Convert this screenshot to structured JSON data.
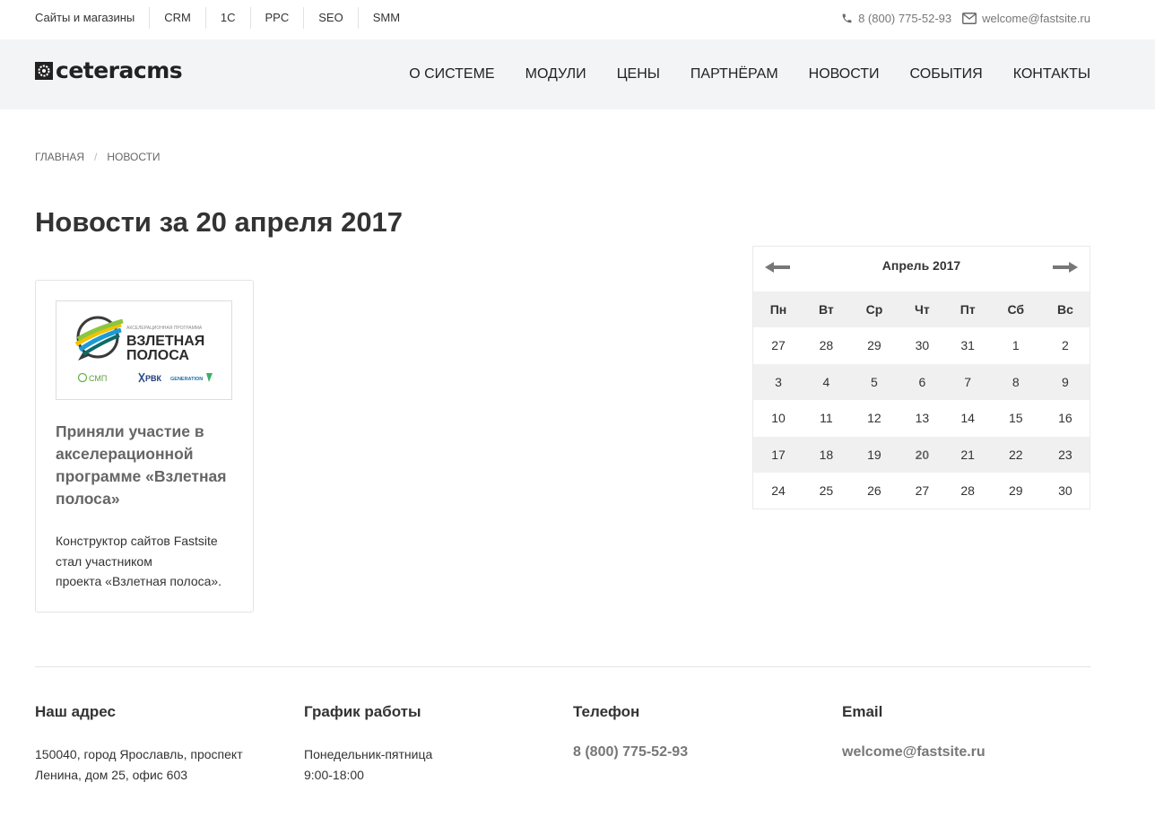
{
  "topbar": {
    "links": [
      "Сайты и магазины",
      "CRM",
      "1С",
      "PPC",
      "SEO",
      "SMM"
    ],
    "phone": "8 (800) 775-52-93",
    "email": "welcome@fastsite.ru",
    "phone_icon": "phone-icon",
    "email_icon": "envelope-icon"
  },
  "header": {
    "logo_text": "ceteracms",
    "nav": [
      "О СИСТЕМЕ",
      "МОДУЛИ",
      "ЦЕНЫ",
      "ПАРТНЁРАМ",
      "НОВОСТИ",
      "СОБЫТИЯ",
      "КОНТАКТЫ"
    ]
  },
  "breadcrumb": {
    "items": [
      "ГЛАВНАЯ",
      "НОВОСТИ"
    ],
    "separator": "/"
  },
  "page_title": "Новости за 20 апреля 2017",
  "news": [
    {
      "image": {
        "small_text": "АКСЕЛЕРАЦИОННАЯ ПРОГРАММА",
        "title_line1": "ВЗЛЕТНАЯ",
        "title_line2": "ПОЛОСА",
        "partner1": "СМП",
        "partner2": "РВК",
        "partner3": "GENERATION"
      },
      "title": "Приняли участие в акселерационной программе «Взлетная полоса»",
      "text_lines": [
        "Конструктор сайтов Fastsite",
        "стал участником",
        "проекта «Взлетная полоса»."
      ]
    }
  ],
  "calendar": {
    "month_label": "Апрель 2017",
    "weekdays": [
      "Пн",
      "Вт",
      "Ср",
      "Чт",
      "Пт",
      "Сб",
      "Вс"
    ],
    "weeks": [
      [
        "27",
        "28",
        "29",
        "30",
        "31",
        "1",
        "2"
      ],
      [
        "3",
        "4",
        "5",
        "6",
        "7",
        "8",
        "9"
      ],
      [
        "10",
        "11",
        "12",
        "13",
        "14",
        "15",
        "16"
      ],
      [
        "17",
        "18",
        "19",
        "20",
        "21",
        "22",
        "23"
      ],
      [
        "24",
        "25",
        "26",
        "27",
        "28",
        "29",
        "30"
      ]
    ],
    "active_day": "20",
    "prev_icon": "arrow-left-icon",
    "next_icon": "arrow-right-icon"
  },
  "footer": {
    "address": {
      "heading": "Наш адрес",
      "lines": [
        "150040, город Ярославль, проспект",
        "Ленина, дом 25, офис 603"
      ]
    },
    "schedule": {
      "heading": "График работы",
      "lines": [
        "Понедельник-пятница",
        "9:00-18:00"
      ]
    },
    "phone": {
      "heading": "Телефон",
      "value": "8 (800) 775-52-93"
    },
    "email": {
      "heading": "Email",
      "value": "welcome@fastsite.ru"
    }
  },
  "colors": {
    "header_bg": "#f3f4f5",
    "calendar_alt_bg": "#f0f0f0",
    "text": "#333333",
    "muted": "#777777"
  }
}
